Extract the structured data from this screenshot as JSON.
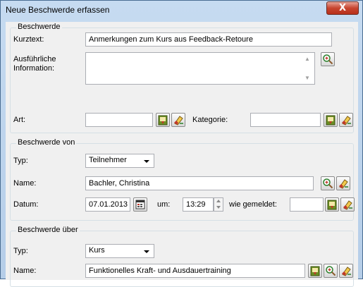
{
  "window": {
    "title": "Neue Beschwerde erfassen",
    "close_glyph": "X"
  },
  "beschwerde": {
    "group_label": "Beschwerde",
    "kurztext_label": "Kurztext:",
    "kurztext_value": "Anmerkungen zum Kurs aus Feedback-Retoure",
    "info_label_line1": "Ausführliche",
    "info_label_line2": "Information:",
    "info_value": "",
    "art_label": "Art:",
    "art_value": "",
    "kategorie_label": "Kategorie:",
    "kategorie_value": ""
  },
  "von": {
    "group_label": "Beschwerde von",
    "typ_label": "Typ:",
    "typ_value": "Teilnehmer",
    "name_label": "Name:",
    "name_value": "Bachler, Christina",
    "datum_label": "Datum:",
    "datum_value": "07.01.2013",
    "um_label": "um:",
    "time_value": "13:29",
    "gemeldet_label": "wie gemeldet:",
    "gemeldet_value": ""
  },
  "ueber": {
    "group_label": "Beschwerde über",
    "typ_label": "Typ:",
    "typ_value": "Kurs",
    "name_label": "Name:",
    "name_value": "Funktionelles Kraft- und Ausdauertraining"
  },
  "colors": {
    "title_bg": "#c6dbf1",
    "close_red": "#c7452f",
    "client_bg": "#f0f0f0"
  },
  "icons": [
    "close-icon",
    "magnifier-icon",
    "clipboard-icon",
    "eraser-icon",
    "calendar-icon"
  ]
}
